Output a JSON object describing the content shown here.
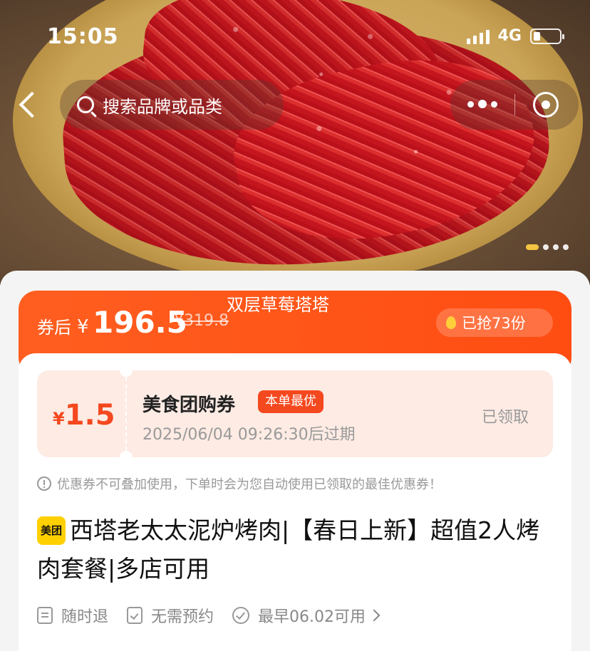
{
  "status_bar": {
    "time": "15:05",
    "network": "4G"
  },
  "nav": {
    "search_placeholder": "搜索品牌或品类"
  },
  "banner": {
    "title": "双层草莓塔塔",
    "price_label": "券后",
    "currency": "¥",
    "price": "196.5",
    "original_price": "¥319.8",
    "sold_text": "已抢73份"
  },
  "coupon": {
    "currency": "¥",
    "amount": "1.5",
    "name": "美食团购券",
    "tag": "本单最优",
    "expire": "2025/06/04 09:26:30后过期",
    "status": "已领取"
  },
  "notice": "优惠券不可叠加使用，下单时会为您自动使用已领取的最佳优惠券！",
  "product": {
    "logo_text": "美团",
    "title": "西塔老太太泥炉烤肉|【春日上新】超值2人烤肉套餐|多店可用"
  },
  "features": [
    {
      "icon": "refund-doc-icon",
      "label": "随时退"
    },
    {
      "icon": "calendar-check-icon",
      "label": "无需预约"
    },
    {
      "icon": "check-circle-icon",
      "label": "最早06.02可用"
    }
  ],
  "colors": {
    "accent": "#ff4d12",
    "coupon_bg": "#fdebe4",
    "logo": "#ffd000"
  }
}
